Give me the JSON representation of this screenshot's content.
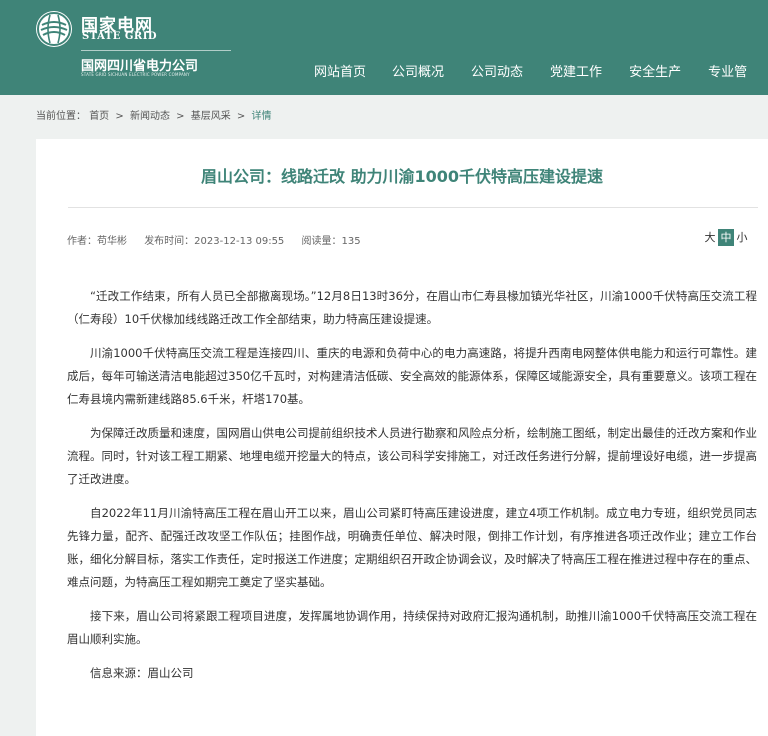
{
  "header": {
    "brand_cn": "国家电网",
    "brand_en": "STATE GRID",
    "company_cn": "国网四川省电力公司",
    "company_en": "STATE GRID SICHUAN ELECTRIC POWER COMPANY",
    "colors": {
      "primary": "#3f8478",
      "white": "#ffffff"
    },
    "logo_icon": "state-grid-logo-icon"
  },
  "nav": {
    "items": [
      {
        "label": "网站首页"
      },
      {
        "label": "公司概况"
      },
      {
        "label": "公司动态"
      },
      {
        "label": "党建工作"
      },
      {
        "label": "安全生产"
      },
      {
        "label": "专业管"
      }
    ]
  },
  "breadcrumb": {
    "prefix": "当前位置：",
    "items": [
      "首页",
      "新闻动态",
      "基层风采",
      "详情"
    ],
    "separator": ">"
  },
  "article": {
    "title": "眉山公司：线路迁改 助力川渝1000千伏特高压建设提速",
    "author": "作者：苟华彬",
    "published": "发布时间：2023-12-13 09:55",
    "reads": "阅读量：135",
    "font_size": {
      "large": "大",
      "medium": "中",
      "small": "小",
      "selected": "中"
    },
    "paragraphs": [
      "“迁改工作结束，所有人员已全部撤离现场。”12月8日13时36分，在眉山市仁寿县椽加镇光华社区，川渝1000千伏特高压交流工程（仁寿段）10千伏椽加线线路迁改工作全部结束，助力特高压建设提速。",
      "川渝1000千伏特高压交流工程是连接四川、重庆的电源和负荷中心的电力高速路，将提升西南电网整体供电能力和运行可靠性。建成后，每年可输送清洁电能超过350亿千瓦时，对构建清洁低碳、安全高效的能源体系，保障区域能源安全，具有重要意义。该项工程在仁寿县境内需新建线路85.6千米，杆塔170基。",
      "为保障迁改质量和速度，国网眉山供电公司提前组织技术人员进行勘察和风险点分析，绘制施工图纸，制定出最佳的迁改方案和作业流程。同时，针对该工程工期紧、地埋电缆开挖量大的特点，该公司科学安排施工，对迁改任务进行分解，提前埋设好电缆，进一步提高了迁改进度。",
      "自2022年11月川渝特高压工程在眉山开工以来，眉山公司紧盯特高压建设进度，建立4项工作机制。成立电力专班，组织党员同志先锋力量，配齐、配强迁改攻坚工作队伍；挂图作战，明确责任单位、解决时限，倒排工作计划，有序推进各项迁改作业；建立工作台账，细化分解目标，落实工作责任，定时报送工作进度；定期组织召开政企协调会议，及时解决了特高压工程在推进过程中存在的重点、难点问题，为特高压工程如期完工奠定了坚实基础。",
      "接下来，眉山公司将紧跟工程项目进度，发挥属地协调作用，持续保持对政府汇报沟通机制，助推川渝1000千伏特高压交流工程在眉山顺利实施。"
    ],
    "source": "信息来源：眉山公司"
  }
}
